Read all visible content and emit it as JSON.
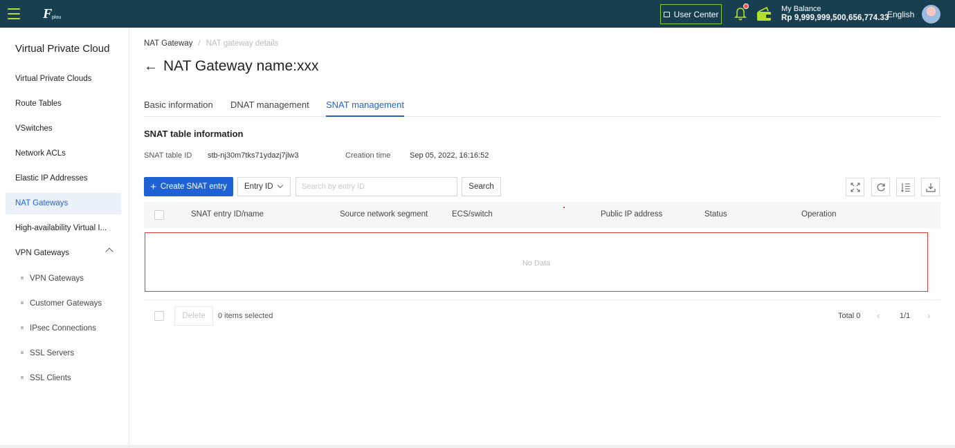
{
  "header": {
    "user_center": "User Center",
    "balance_label": "My Balance",
    "balance_value": "Rp 9,999,999,500,656,774.33",
    "language": "English",
    "logo_text": "plou"
  },
  "sidebar": {
    "title": "Virtual Private Cloud",
    "items": [
      {
        "label": "Virtual Private Clouds"
      },
      {
        "label": "Route Tables"
      },
      {
        "label": "VSwitches"
      },
      {
        "label": "Network ACLs"
      },
      {
        "label": "Elastic IP Addresses"
      },
      {
        "label": "NAT Gateways",
        "active": true
      },
      {
        "label": "High-availability Virtual I..."
      },
      {
        "label": "VPN Gateways",
        "expanded": true
      }
    ],
    "sub_items": [
      {
        "label": "VPN Gateways"
      },
      {
        "label": "Customer Gateways"
      },
      {
        "label": "IPsec Connections"
      },
      {
        "label": "SSL Servers"
      },
      {
        "label": "SSL Clients"
      }
    ]
  },
  "breadcrumb": {
    "parent": "NAT Gateway",
    "separator": "/",
    "current": "NAT gateway details"
  },
  "page": {
    "title": "NAT Gateway name:xxx"
  },
  "tabs": [
    {
      "label": "Basic information"
    },
    {
      "label": "DNAT management"
    },
    {
      "label": "SNAT management",
      "active": true
    }
  ],
  "section": {
    "title": "SNAT table information",
    "table_id_label": "SNAT table ID",
    "table_id_value": "stb-nj30m7tks71ydazj7jlw3",
    "creation_label": "Creation time",
    "creation_value": "Sep 05, 2022, 16:16:52"
  },
  "toolbar": {
    "create_label": "Create SNAT entry",
    "filter_value": "Entry ID",
    "search_placeholder": "Search by entry ID",
    "search_label": "Search"
  },
  "table": {
    "columns": [
      "SNAT entry ID/name",
      "Source network segment",
      "ECS/switch",
      "Public IP address",
      "Status",
      "Operation"
    ],
    "empty_text": "No Data"
  },
  "footer": {
    "delete_label": "Delete",
    "selected_text": "0 items selected",
    "total_text": "Total 0",
    "page_text": "1/1"
  },
  "colors": {
    "topbar": "#173f4f",
    "accent": "#1f62d6",
    "highlight_border": "#e53935",
    "brand_green": "#b3e02f"
  }
}
